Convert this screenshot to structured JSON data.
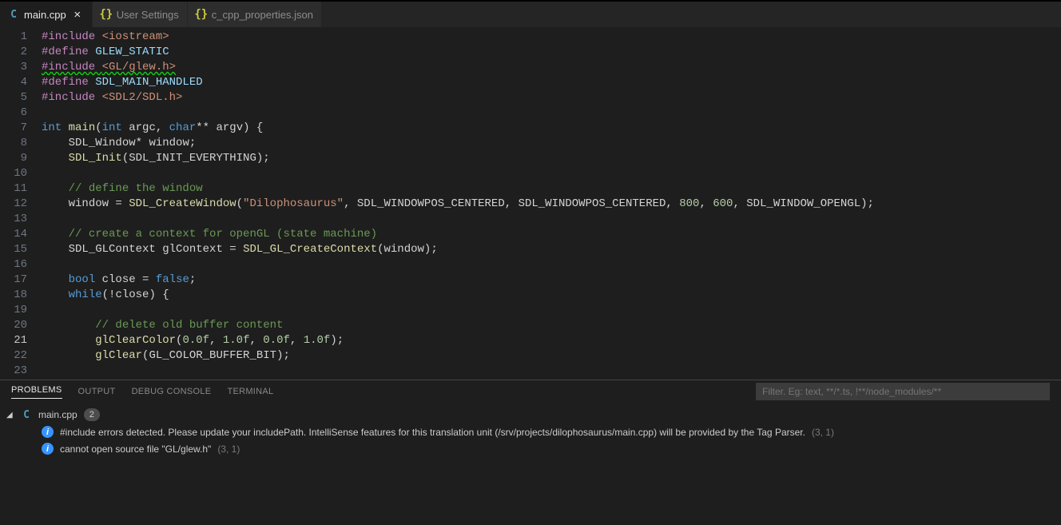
{
  "tabs": {
    "items": [
      {
        "label": "main.cpp",
        "icon": "cpp",
        "active": true,
        "dirty": false
      },
      {
        "label": "User Settings",
        "icon": "json",
        "active": false,
        "dirty": false
      },
      {
        "label": "c_cpp_properties.json",
        "icon": "json",
        "active": false,
        "dirty": false
      }
    ]
  },
  "editor": {
    "active_line": 21,
    "lines": [
      {
        "n": 1,
        "tokens": [
          [
            "#include ",
            "macro"
          ],
          [
            "<iostream>",
            "inc"
          ]
        ]
      },
      {
        "n": 2,
        "tokens": [
          [
            "#define ",
            "macro"
          ],
          [
            "GLEW_STATIC",
            "def"
          ]
        ]
      },
      {
        "n": 3,
        "err": true,
        "tokens": [
          [
            "#include ",
            "macro"
          ],
          [
            "<GL/glew.h>",
            "inc"
          ]
        ]
      },
      {
        "n": 4,
        "tokens": [
          [
            "#define ",
            "macro"
          ],
          [
            "SDL_MAIN_HANDLED",
            "def"
          ]
        ]
      },
      {
        "n": 5,
        "tokens": [
          [
            "#include ",
            "macro"
          ],
          [
            "<SDL2/SDL.h>",
            "inc"
          ]
        ]
      },
      {
        "n": 6,
        "tokens": []
      },
      {
        "n": 7,
        "tokens": [
          [
            "int ",
            "type"
          ],
          [
            "main",
            "fn"
          ],
          [
            "(",
            "punc"
          ],
          [
            "int ",
            "type"
          ],
          [
            "argc",
            "id"
          ],
          [
            ", ",
            "punc"
          ],
          [
            "char",
            "type"
          ],
          [
            "** ",
            "punc"
          ],
          [
            "argv",
            "id"
          ],
          [
            ") {",
            "punc"
          ]
        ]
      },
      {
        "n": 8,
        "indent": 1,
        "tokens": [
          [
            "SDL_Window",
            "id"
          ],
          [
            "* ",
            "punc"
          ],
          [
            "window",
            "id"
          ],
          [
            ";",
            "punc"
          ]
        ]
      },
      {
        "n": 9,
        "indent": 1,
        "tokens": [
          [
            "SDL_Init",
            "fn"
          ],
          [
            "(",
            "punc"
          ],
          [
            "SDL_INIT_EVERYTHING",
            "const"
          ],
          [
            ");",
            "punc"
          ]
        ]
      },
      {
        "n": 10,
        "indent": 1,
        "tokens": []
      },
      {
        "n": 11,
        "indent": 1,
        "tokens": [
          [
            "// define the window",
            "com"
          ]
        ]
      },
      {
        "n": 12,
        "indent": 1,
        "tokens": [
          [
            "window ",
            "id"
          ],
          [
            "= ",
            "punc"
          ],
          [
            "SDL_CreateWindow",
            "fn"
          ],
          [
            "(",
            "punc"
          ],
          [
            "\"Dilophosaurus\"",
            "str"
          ],
          [
            ", ",
            "punc"
          ],
          [
            "SDL_WINDOWPOS_CENTERED",
            "const"
          ],
          [
            ", ",
            "punc"
          ],
          [
            "SDL_WINDOWPOS_CENTERED",
            "const"
          ],
          [
            ", ",
            "punc"
          ],
          [
            "800",
            "num"
          ],
          [
            ", ",
            "punc"
          ],
          [
            "600",
            "num"
          ],
          [
            ", ",
            "punc"
          ],
          [
            "SDL_WINDOW_OPENGL",
            "const"
          ],
          [
            ");",
            "punc"
          ]
        ]
      },
      {
        "n": 13,
        "indent": 1,
        "tokens": []
      },
      {
        "n": 14,
        "indent": 1,
        "tokens": [
          [
            "// create a context for openGL (state machine)",
            "com"
          ]
        ]
      },
      {
        "n": 15,
        "indent": 1,
        "tokens": [
          [
            "SDL_GLContext ",
            "id"
          ],
          [
            "glContext ",
            "id"
          ],
          [
            "= ",
            "punc"
          ],
          [
            "SDL_GL_CreateContext",
            "fn"
          ],
          [
            "(",
            "punc"
          ],
          [
            "window",
            "id"
          ],
          [
            ");",
            "punc"
          ]
        ]
      },
      {
        "n": 16,
        "indent": 1,
        "tokens": []
      },
      {
        "n": 17,
        "indent": 1,
        "tokens": [
          [
            "bool ",
            "type"
          ],
          [
            "close ",
            "id"
          ],
          [
            "= ",
            "punc"
          ],
          [
            "false",
            "bool"
          ],
          [
            ";",
            "punc"
          ]
        ]
      },
      {
        "n": 18,
        "indent": 1,
        "tokens": [
          [
            "while",
            "key"
          ],
          [
            "(",
            "punc"
          ],
          [
            "!",
            "punc"
          ],
          [
            "close",
            "id"
          ],
          [
            ") {",
            "punc"
          ]
        ]
      },
      {
        "n": 19,
        "indent": 2,
        "tokens": []
      },
      {
        "n": 20,
        "indent": 2,
        "tokens": [
          [
            "// delete old buffer content",
            "com"
          ]
        ]
      },
      {
        "n": 21,
        "indent": 2,
        "tokens": [
          [
            "glClearColor",
            "fn"
          ],
          [
            "(",
            "punc"
          ],
          [
            "0.0f",
            "num"
          ],
          [
            ", ",
            "punc"
          ],
          [
            "1.0f",
            "num"
          ],
          [
            ", ",
            "punc"
          ],
          [
            "0.0f",
            "num"
          ],
          [
            ", ",
            "punc"
          ],
          [
            "1.0f",
            "num"
          ],
          [
            ");",
            "punc"
          ]
        ]
      },
      {
        "n": 22,
        "indent": 2,
        "tokens": [
          [
            "glClear",
            "fn"
          ],
          [
            "(",
            "punc"
          ],
          [
            "GL_COLOR_BUFFER_BIT",
            "const"
          ],
          [
            ");",
            "punc"
          ]
        ]
      },
      {
        "n": 23,
        "indent": 2,
        "tokens": []
      }
    ]
  },
  "panel": {
    "tabs": {
      "problems": "PROBLEMS",
      "output": "OUTPUT",
      "debug": "DEBUG CONSOLE",
      "terminal": "TERMINAL"
    },
    "filter_placeholder": "Filter. Eg: text, **/*.ts, !**/node_modules/**",
    "file": {
      "name": "main.cpp",
      "count": "2"
    },
    "items": [
      {
        "severity": "info",
        "msg": "#include errors detected. Please update your includePath. IntelliSense features for this translation unit (/srv/projects/dilophosaurus/main.cpp) will be provided by the Tag Parser.",
        "loc": "(3, 1)"
      },
      {
        "severity": "info",
        "msg": "cannot open source file \"GL/glew.h\"",
        "loc": "(3, 1)"
      }
    ]
  }
}
